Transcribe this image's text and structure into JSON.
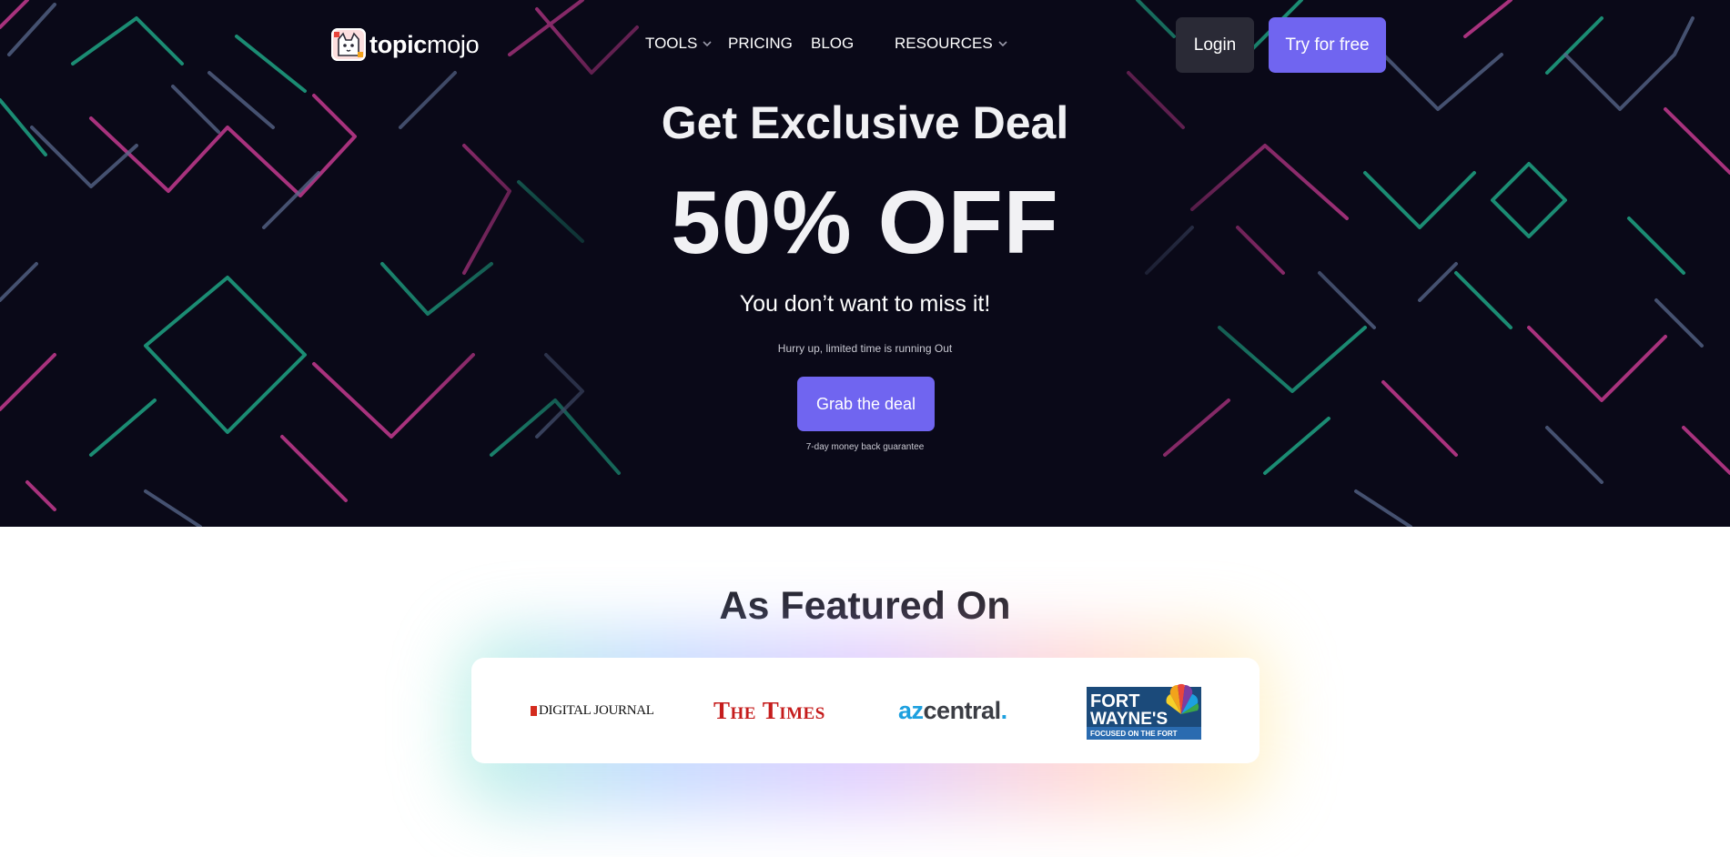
{
  "nav": {
    "logo_bold": "topic",
    "logo_light": "mojo",
    "items": [
      {
        "label": "TOOLS",
        "has_dropdown": true
      },
      {
        "label": "PRICING",
        "has_dropdown": false
      },
      {
        "label": "BLOG",
        "has_dropdown": false
      },
      {
        "label": "RESOURCES",
        "has_dropdown": true
      }
    ],
    "login_label": "Login",
    "try_label": "Try for free"
  },
  "hero": {
    "title": "Get Exclusive Deal",
    "discount": "50% OFF",
    "subtitle": "You don’t want to miss it!",
    "note": "Hurry up, limited time is running Out",
    "cta_label": "Grab the deal",
    "guarantee": "7-day money back guarantee"
  },
  "featured": {
    "title": "As Featured On",
    "logos": [
      {
        "name": "DIGITAL JOURNAL"
      },
      {
        "name": "The Times"
      },
      {
        "name_a": "az",
        "name_b": "central",
        "name_c": "."
      },
      {
        "line1": "FORT",
        "line2": "WAYNE'S",
        "tagline": "FOCUSED ON THE FORT"
      }
    ]
  },
  "colors": {
    "hero_bg": "#0a0918",
    "accent": "#7065f0",
    "login_bg": "#2a2a36",
    "neon_pink": "#c43a8f",
    "neon_green": "#1fa384",
    "neon_slate": "#5a6a8e"
  }
}
